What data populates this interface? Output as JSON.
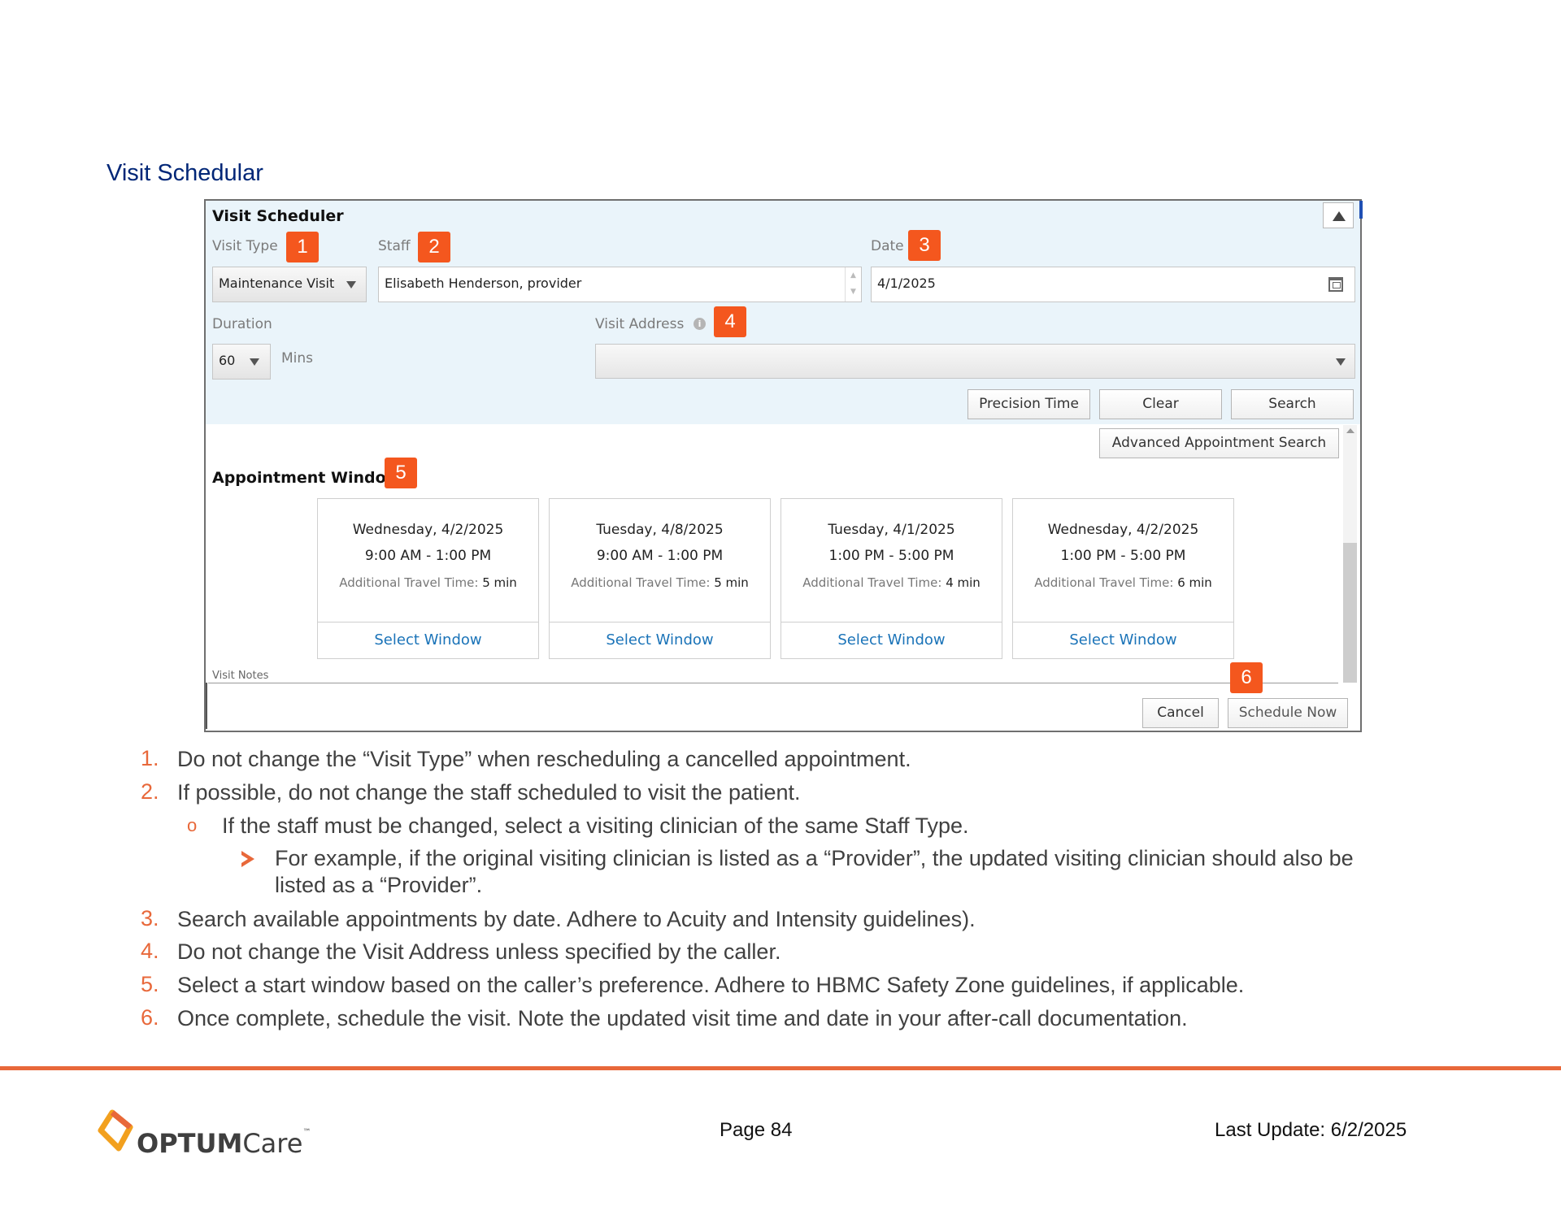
{
  "section_title": "Visit Schedular",
  "scheduler": {
    "title": "Visit Scheduler",
    "visit_type_label": "Visit Type",
    "visit_type_value": "Maintenance Visit",
    "staff_label": "Staff",
    "staff_value": "Elisabeth Henderson, provider",
    "date_label": "Date",
    "date_value": "4/1/2025",
    "duration_label": "Duration",
    "duration_value": "60",
    "duration_unit": "Mins",
    "visit_address_label": "Visit Address",
    "visit_address_value": "",
    "buttons": {
      "precision_time": "Precision Time",
      "clear": "Clear",
      "search": "Search",
      "advanced_search": "Advanced Appointment Search",
      "cancel": "Cancel",
      "schedule_now": "Schedule Now"
    },
    "appointment_window_title": "Appointment Window",
    "travel_time_label": "Additional Travel Time:",
    "select_label": "Select Window",
    "windows": [
      {
        "date": "Wednesday, 4/2/2025",
        "time": "9:00 AM - 1:00 PM",
        "travel": "5 min"
      },
      {
        "date": "Tuesday, 4/8/2025",
        "time": "9:00 AM - 1:00 PM",
        "travel": "5 min"
      },
      {
        "date": "Tuesday, 4/1/2025",
        "time": "1:00 PM - 5:00 PM",
        "travel": "4 min"
      },
      {
        "date": "Wednesday, 4/2/2025",
        "time": "1:00 PM - 5:00 PM",
        "travel": "6 min"
      }
    ],
    "visit_notes_label": "Visit Notes"
  },
  "callouts": [
    "1",
    "2",
    "3",
    "4",
    "5",
    "6"
  ],
  "instructions": [
    {
      "num": "1.",
      "text": "Do not change the “Visit Type” when rescheduling a cancelled appointment."
    },
    {
      "num": "2.",
      "text": "If possible, do not change the staff scheduled to visit the patient."
    },
    {
      "num": "3.",
      "text": "Search available appointments by date. Adhere to Acuity and Intensity guidelines)."
    },
    {
      "num": "4.",
      "text": "Do not change the Visit Address unless specified by the caller."
    },
    {
      "num": "5.",
      "text": "Select a start window based on the caller’s preference. Adhere to HBMC Safety Zone guidelines, if applicable."
    },
    {
      "num": "6.",
      "text": "Once complete, schedule the visit. Note the updated visit time and date in your after-call documentation."
    }
  ],
  "sub_bullet": "If the staff must be changed, select a visiting clinician of the same Staff Type.",
  "sub_sub_bullet_line1": "For example, if the original visiting clinician is listed as a “Provider”, the updated visiting clinician should also be",
  "sub_sub_bullet_line2": "listed as a “Provider”.",
  "footer": {
    "logo_optum": "OPTUM",
    "logo_care": "Care",
    "logo_tm": "™",
    "page": "Page 84",
    "last_update": "Last Update: 6/2/2025"
  },
  "colors": {
    "accent": "#e8683a",
    "badge": "#f4571e",
    "title_blue": "#002677",
    "link_blue": "#1a73b8"
  }
}
